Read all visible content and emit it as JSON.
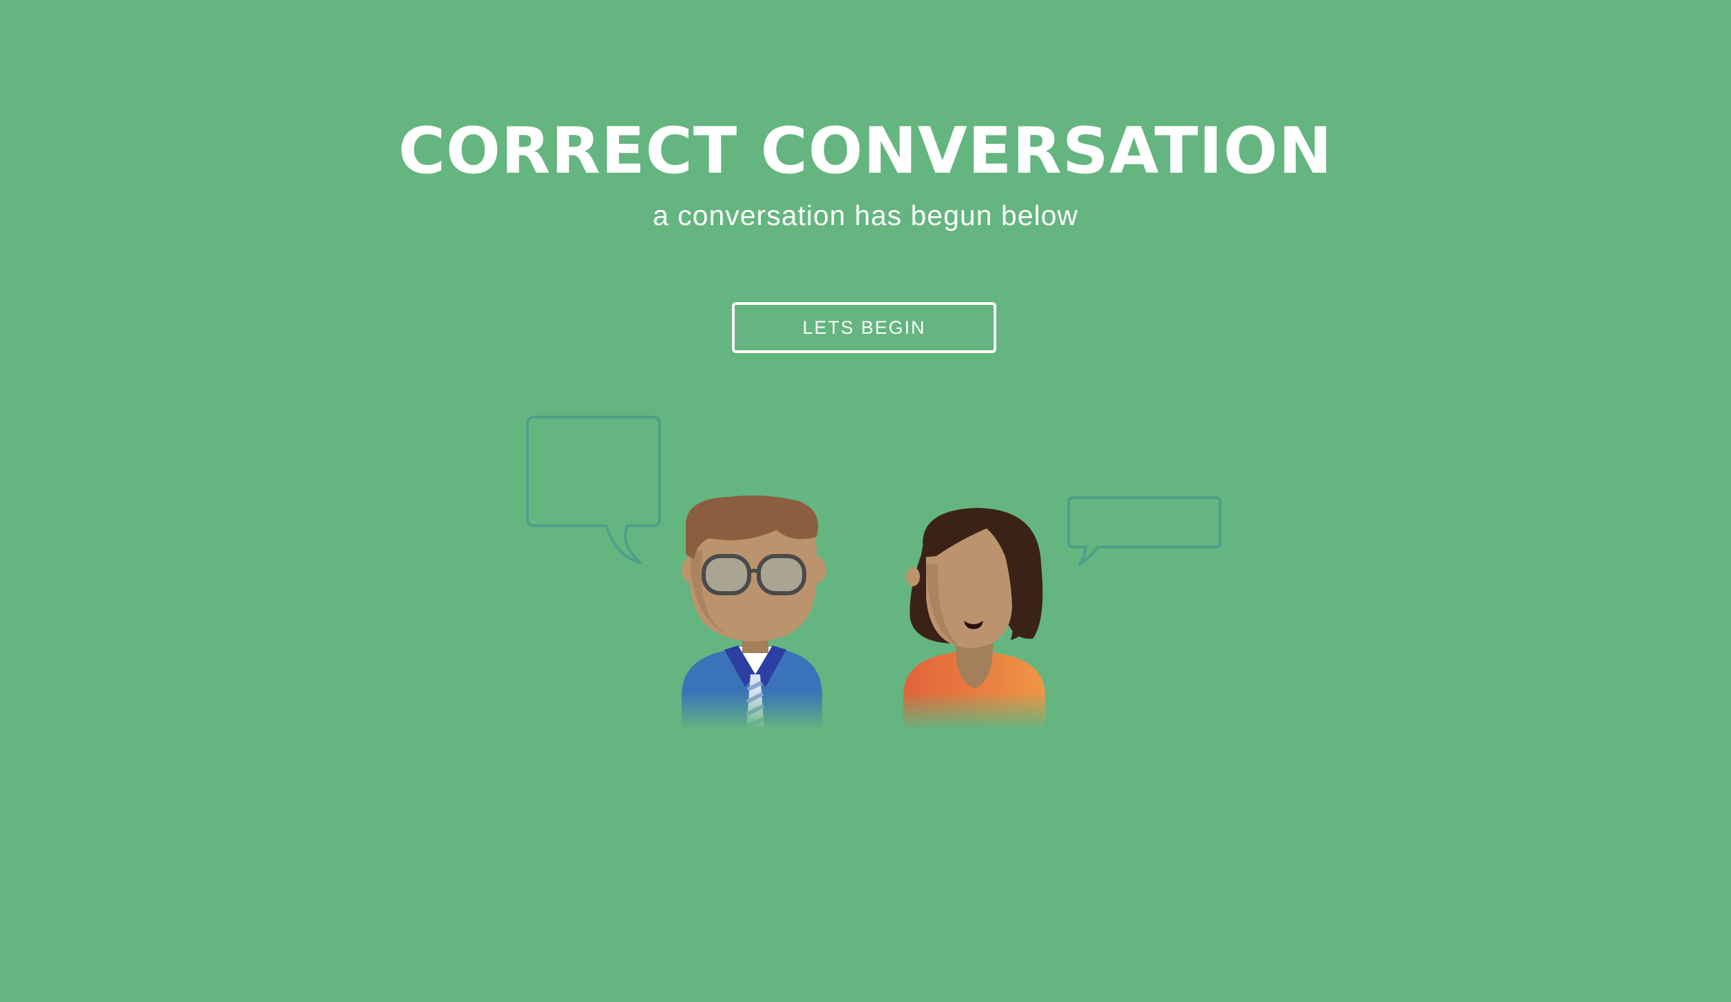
{
  "hero": {
    "title": "CORRECT CONVERSATION",
    "subtitle": "a conversation has begun below",
    "button_label": "LETS BEGIN"
  },
  "colors": {
    "background": "#64b57f",
    "text": "#ffffff",
    "bubble_outline": "#4fa08a",
    "man_hair": "#8b5e3f",
    "man_shirt": "#3b73b8",
    "woman_hair": "#3b2218",
    "woman_shirt": "#e8683a",
    "skin": "#bb946d"
  },
  "illustration": {
    "left_bubble_icon": "speech-bubble-large-icon",
    "right_bubble_icon": "speech-bubble-small-icon",
    "man_icon": "man-with-glasses-avatar-icon",
    "woman_icon": "woman-avatar-icon"
  }
}
